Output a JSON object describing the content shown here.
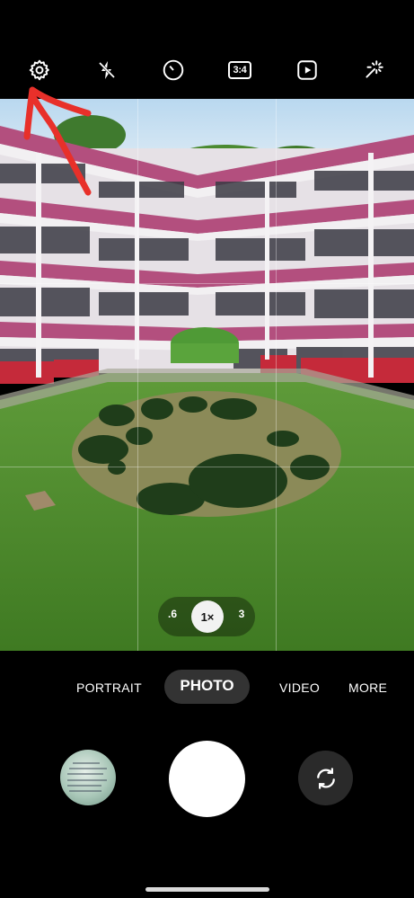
{
  "top_bar": {
    "icons": [
      "settings-gear-icon",
      "flash-off-icon",
      "timer-icon",
      "aspect-ratio-icon",
      "motion-photo-icon",
      "filters-icon"
    ],
    "aspect_ratio": "3:4"
  },
  "zoom": {
    "options": [
      ".6",
      "1×",
      "3"
    ],
    "selected": "1×"
  },
  "modes": {
    "items": [
      "PORTRAIT",
      "PHOTO",
      "VIDEO",
      "MORE"
    ],
    "selected": "PHOTO"
  },
  "colors": {
    "background": "#000000",
    "annotation_arrow": "#e8302a",
    "mode_active_bg": "#333333"
  }
}
